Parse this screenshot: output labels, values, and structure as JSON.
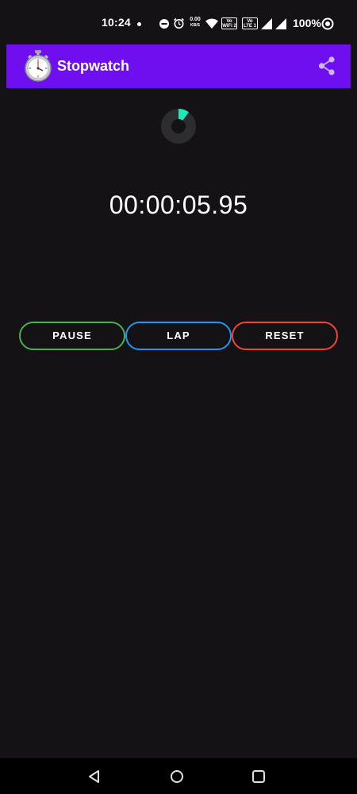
{
  "status_bar": {
    "time": "10:24",
    "network_speed_value": "0.00",
    "network_speed_unit": "KB/S",
    "wifi_tag": "Vo WiFi 2",
    "lte_tag": "Vo LTE 1",
    "battery": "100%",
    "icons": [
      "dnd-icon",
      "alarm-icon",
      "wifi-icon",
      "signal-icon",
      "signal-icon",
      "target-icon"
    ]
  },
  "app_bar": {
    "title": "Stopwatch",
    "logo_icon": "stopwatch-icon",
    "share_icon": "share-icon",
    "background": "#6f0ff0"
  },
  "progress": {
    "fraction": 0.1,
    "track_color": "#2d2d2f",
    "fill_color": "#1de9b6"
  },
  "timer": {
    "display": "00:00:05.95"
  },
  "controls": {
    "pause_label": "PAUSE",
    "lap_label": "LAP",
    "reset_label": "RESET",
    "pause_color": "#4caf50",
    "lap_color": "#2196f3",
    "reset_color": "#f44336"
  },
  "nav_bar": {
    "icons": [
      "back-icon",
      "home-icon",
      "recents-icon"
    ]
  }
}
